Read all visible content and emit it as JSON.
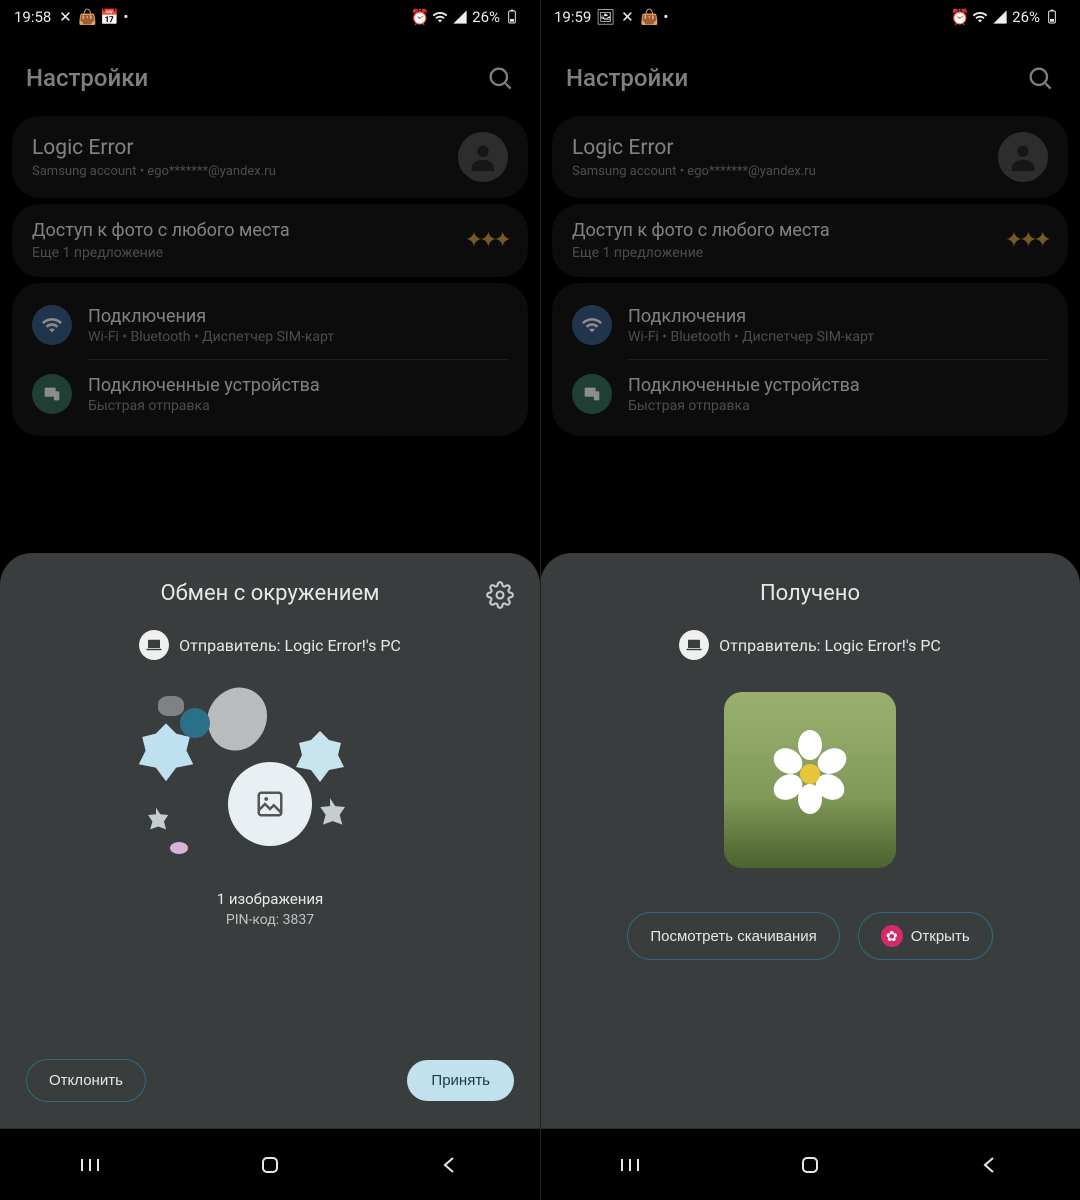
{
  "left": {
    "status": {
      "time": "19:58",
      "battery": "26%"
    },
    "settings": {
      "title": "Настройки",
      "account": {
        "name": "Logic Error",
        "sub": "Samsung account  •  ego*******@yandex.ru"
      },
      "promo": {
        "title": "Доступ к фото с любого места",
        "sub": "Еще 1 предложение"
      },
      "items": [
        {
          "title": "Подключения",
          "sub": "Wi-Fi  •  Bluetooth  •  Диспетчер SIM-карт"
        },
        {
          "title": "Подключенные устройства",
          "sub": "Быстрая отправка"
        }
      ]
    },
    "sheet": {
      "title": "Обмен с окружением",
      "sender_label": "Отправитель: Logic Error!'s PC",
      "count_label": "1 изображения",
      "pin_label": "PIN-код: 3837",
      "decline": "Отклонить",
      "accept": "Принять"
    }
  },
  "right": {
    "status": {
      "time": "19:59",
      "battery": "26%"
    },
    "settings": {
      "title": "Настройки",
      "account": {
        "name": "Logic Error",
        "sub": "Samsung account  •  ego*******@yandex.ru"
      },
      "promo": {
        "title": "Доступ к фото с любого места",
        "sub": "Еще 1 предложение"
      },
      "items": [
        {
          "title": "Подключения",
          "sub": "Wi-Fi  •  Bluetooth  •  Диспетчер SIM-карт"
        },
        {
          "title": "Подключенные устройства",
          "sub": "Быстрая отправка"
        }
      ]
    },
    "sheet": {
      "title": "Получено",
      "sender_label": "Отправитель: Logic Error!'s PC",
      "view_downloads": "Посмотреть скачивания",
      "open": "Открыть"
    }
  }
}
